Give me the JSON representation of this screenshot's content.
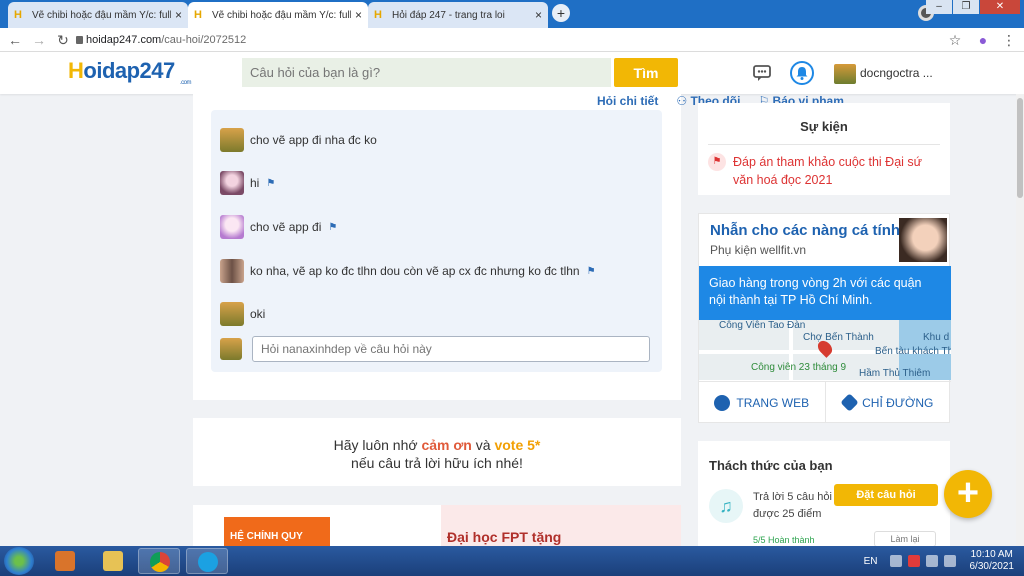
{
  "browser": {
    "tabs": [
      {
        "title": "Vẽ chibi hoặc đậu mầm Y/c: full r",
        "close": "×"
      },
      {
        "title": "Vẽ chibi hoặc đậu mầm Y/c: full r",
        "close": "×"
      },
      {
        "title": "Hỏi đáp 247 - trang tra loi",
        "close": "×"
      }
    ],
    "new_tab": "+",
    "url_host": "hoidap247.com",
    "url_path": "/cau-hoi/2072512"
  },
  "header": {
    "logo_h": "H",
    "logo_rest": "oidap247",
    "logo_com": ".com",
    "search_placeholder": "Câu hỏi của bạn là gì?",
    "search_button": "Tìm",
    "username": "docngoctra ..."
  },
  "question": {
    "links": [
      "Hỏi chi tiết",
      "Theo dõi",
      "Báo vi phạm"
    ],
    "comments": [
      {
        "text": "cho vẽ app đi nha đc ko",
        "flagged": false
      },
      {
        "text": "hi",
        "flagged": true
      },
      {
        "text": "cho vẽ app đi",
        "flagged": true
      },
      {
        "text": "ko nha, vẽ ap ko đc tlhn dou còn vẽ ap cx đc nhưng ko đc tlhn",
        "flagged": true
      },
      {
        "text": "oki",
        "flagged": false
      }
    ],
    "reply_placeholder": "Hỏi nanaxinhdep về câu hỏi này"
  },
  "reminder": {
    "line1_a": "Hãy luôn nhớ ",
    "line1_b": "cảm ơn",
    "line1_c": " và ",
    "line1_d": "vote 5*",
    "line2": "nếu câu trả lời hữu ích nhé!"
  },
  "bottom_ad": {
    "left_text": "HỆ CHÍNH QUY",
    "right_text": "Đại học FPT tặng"
  },
  "sidebar": {
    "event_title": "Sự kiện",
    "event_item": "Đáp án tham khảo cuộc thi Đại sứ văn hoá đọc 2021",
    "ad": {
      "headline": "Nhẫn cho các nàng cá tính",
      "advertiser": "Phụ kiện wellfit.vn",
      "body": "Giao hàng trong vòng 2h với các quận nội thành tại TP Hồ Chí Minh.",
      "map_labels": [
        "Công Viên Tao Đàn",
        "Chợ Bến Thành",
        "Khu d",
        "Bến tàu khách Th",
        "Công viên 23 tháng 9",
        "Hầm Thủ Thiêm"
      ],
      "action_web": "TRANG WEB",
      "action_directions": "CHỈ ĐƯỜNG"
    },
    "challenge": {
      "title": "Thách thức của bạn",
      "desc": "Trả lời 5 câu hỏi trong 24 giờ để được 25 điểm",
      "progress": "5/5   Hoàn thành",
      "retry": "Làm lại"
    },
    "ask_tooltip": "Đặt câu hỏi",
    "ask_fab": "+"
  },
  "taskbar": {
    "lang": "EN",
    "time": "10:10 AM",
    "date": "6/30/2021"
  }
}
